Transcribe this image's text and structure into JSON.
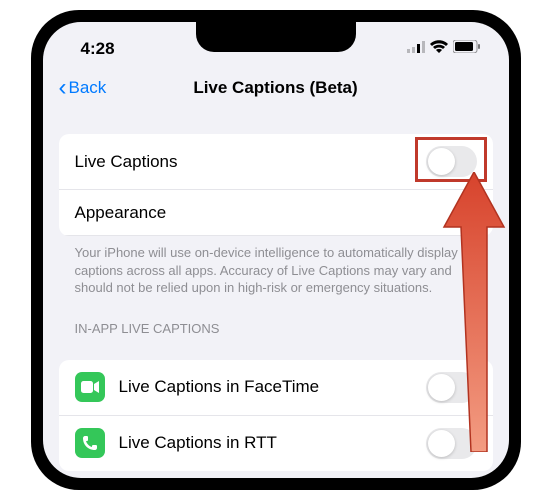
{
  "status_bar": {
    "time": "4:28"
  },
  "nav": {
    "back_label": "Back",
    "title": "Live Captions (Beta)"
  },
  "group1": {
    "live_captions_label": "Live Captions",
    "appearance_label": "Appearance"
  },
  "footer1": "Your iPhone will use on-device intelligence to automatically display captions across all apps. Accuracy of Live Captions may vary and should not be relied upon in high-risk or emergency situations.",
  "section2_header": "IN-APP LIVE CAPTIONS",
  "group2": {
    "facetime_label": "Live Captions in FaceTime",
    "rtt_label": "Live Captions in RTT"
  },
  "colors": {
    "accent": "#007aff",
    "highlight": "#c0392b",
    "arrow": "#e74c3c"
  }
}
